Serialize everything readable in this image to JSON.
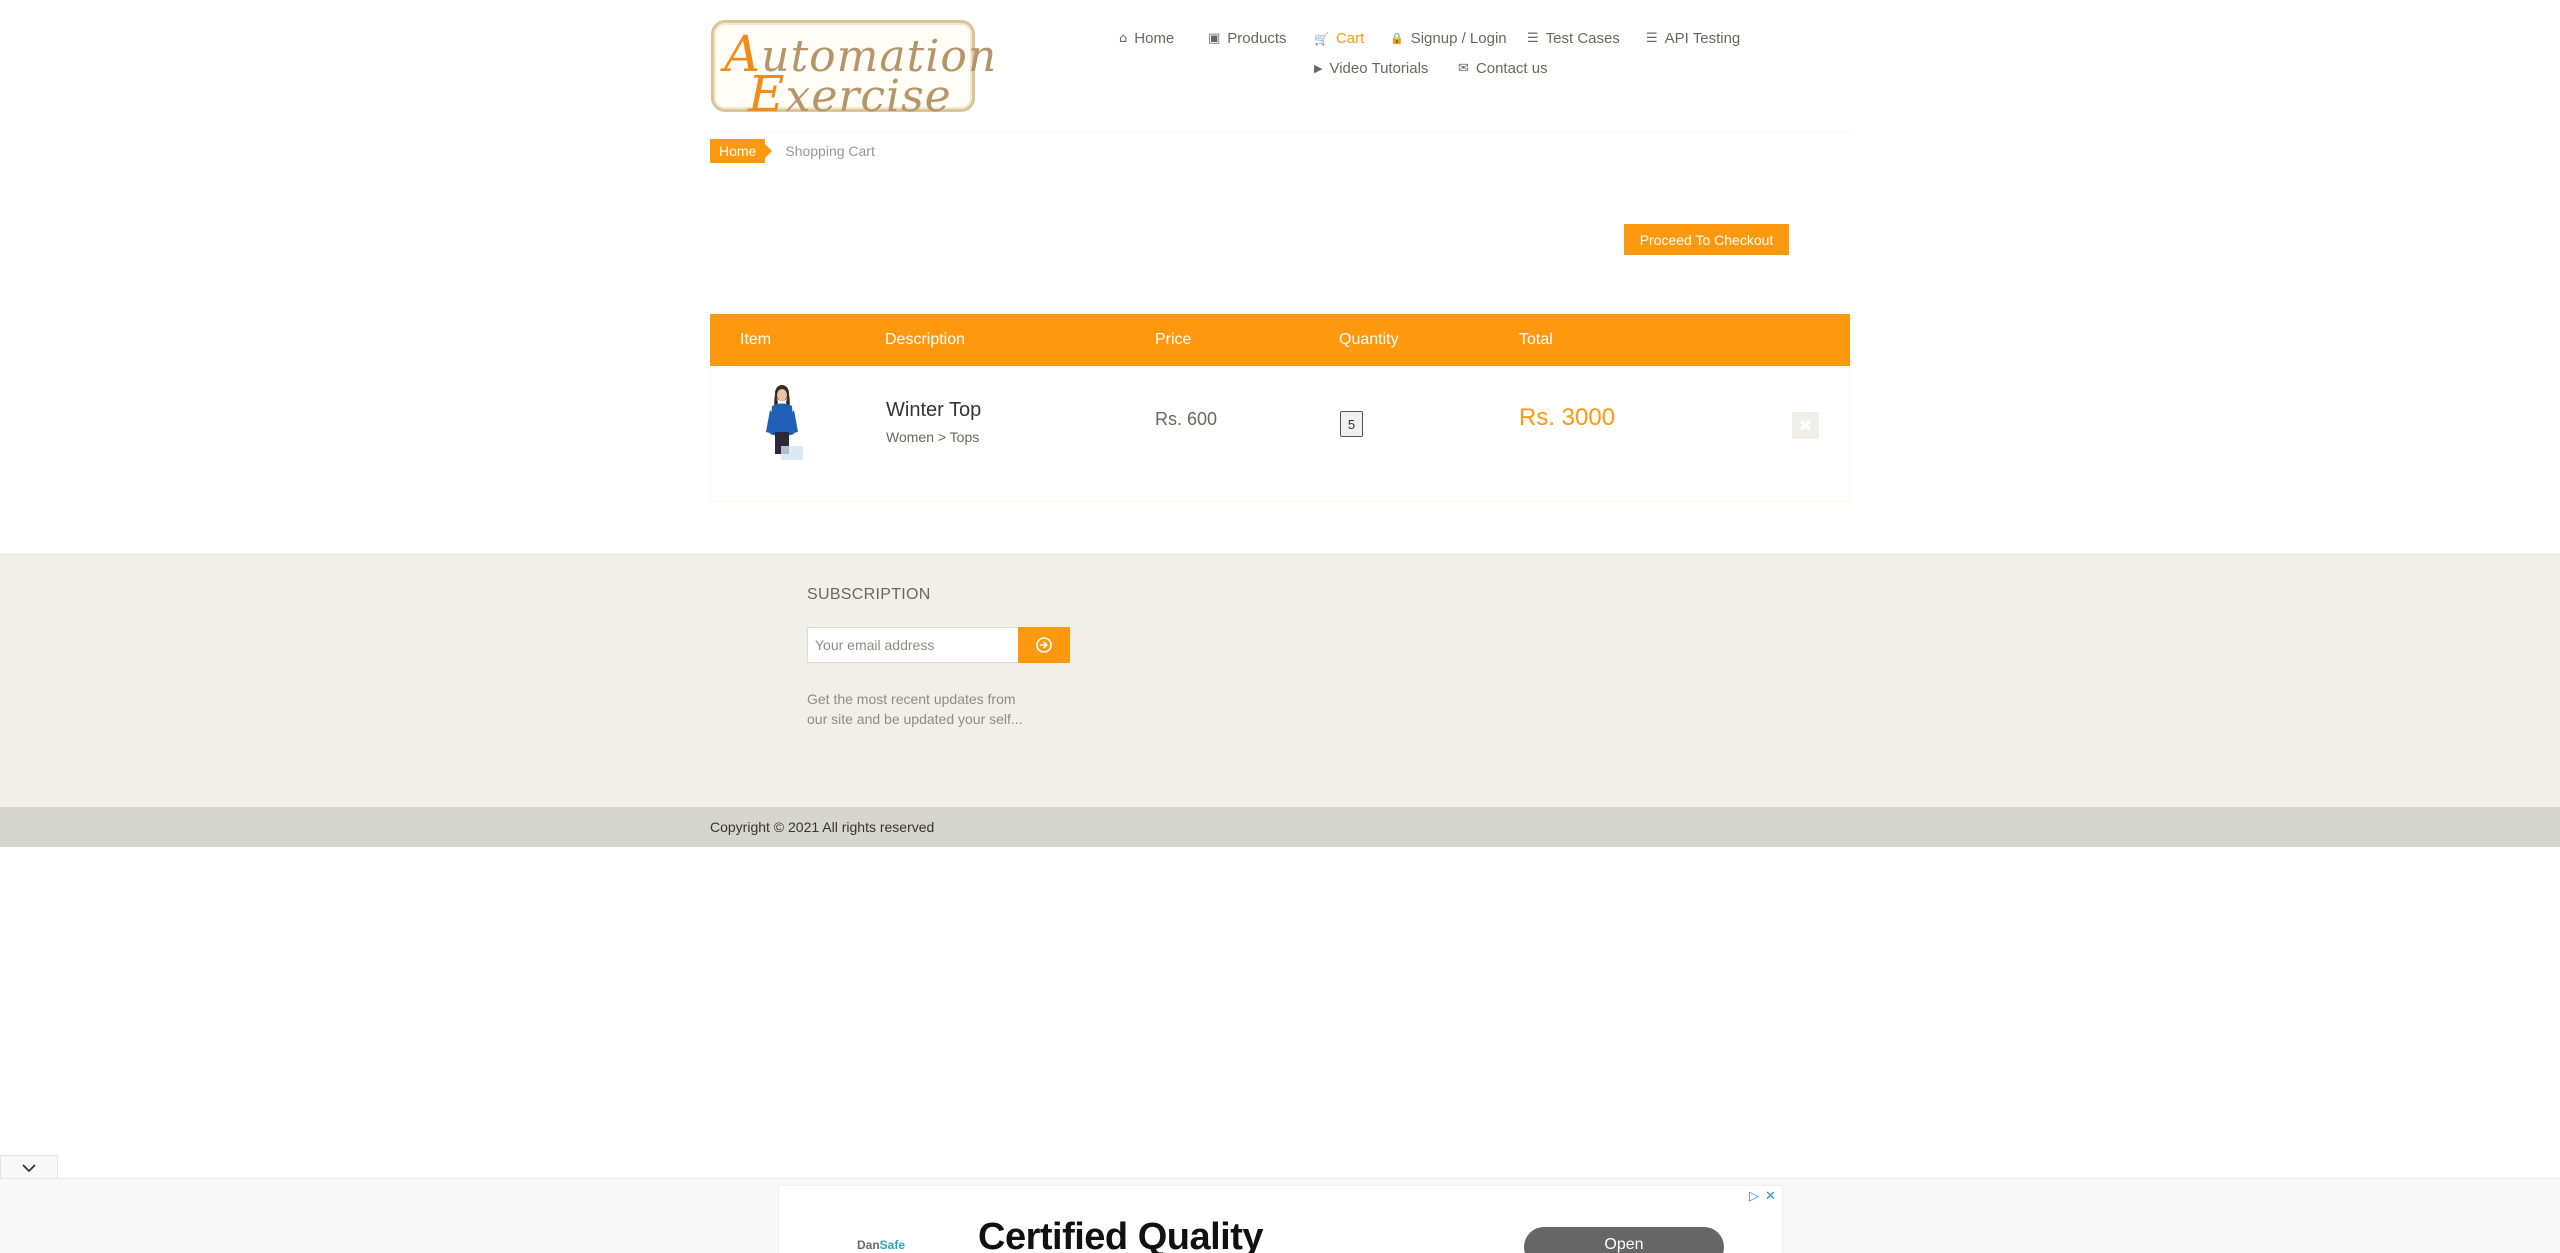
{
  "logo": {
    "line1_cap": "A",
    "line1_rest": "utomation",
    "line2_cap": "E",
    "line2_rest": "xercise"
  },
  "nav": [
    {
      "label": "Home",
      "icon": "home-icon",
      "glyph": "⌂"
    },
    {
      "label": "Products",
      "icon": "products-icon",
      "glyph": "▣"
    },
    {
      "label": "Cart",
      "icon": "cart-icon",
      "glyph": "🛒"
    },
    {
      "label": "Signup / Login",
      "icon": "lock-icon",
      "glyph": "🔒"
    },
    {
      "label": "Test Cases",
      "icon": "list-icon",
      "glyph": "☰"
    },
    {
      "label": "API Testing",
      "icon": "list-icon",
      "glyph": "☰"
    },
    {
      "label": "Video Tutorials",
      "icon": "youtube-icon",
      "glyph": "▶"
    },
    {
      "label": "Contact us",
      "icon": "envelope-icon",
      "glyph": "✉"
    }
  ],
  "breadcrumb": {
    "home": "Home",
    "current": "Shopping Cart"
  },
  "checkout_label": "Proceed To Checkout",
  "cart": {
    "headers": [
      "Item",
      "Description",
      "Price",
      "Quantity",
      "Total",
      ""
    ],
    "items": [
      {
        "name": "Winter Top",
        "category": "Women > Tops",
        "price": "Rs. 600",
        "quantity": "5",
        "total": "Rs. 3000",
        "delete_glyph": "✖"
      }
    ]
  },
  "footer": {
    "subscription_title": "SUBSCRIPTION",
    "email_placeholder": "Your email address",
    "subscription_text": "Get the most recent updates from our site and be updated your self...",
    "copyright": "Copyright © 2021 All rights reserved"
  },
  "ad": {
    "brand_a": "Dan",
    "brand_b": "Safe",
    "headline": "Certified Quality",
    "cta": "Open"
  },
  "colors": {
    "accent": "#fe980f",
    "footer_bg": "#f0f0e9",
    "footer_bottom_bg": "#d6d6d0"
  }
}
